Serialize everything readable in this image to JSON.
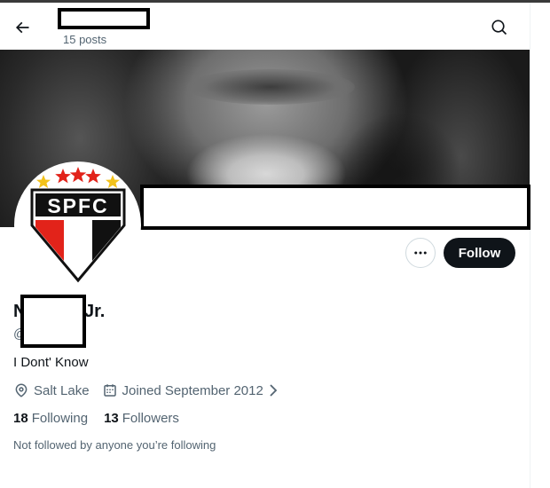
{
  "header": {
    "display_name": "",
    "post_count": "15 posts"
  },
  "profile": {
    "display_name_start": "N",
    "display_name_end": "Jr.",
    "handle_prefix": "@",
    "bio": "I Dont' Know",
    "location": "Salt Lake",
    "joined": "Joined September 2012",
    "following_count": "18",
    "following_label": "Following",
    "followers_count": "13",
    "followers_label": "Followers",
    "not_followed_text": "Not followed by anyone you’re following"
  },
  "actions": {
    "follow_label": "Follow"
  },
  "avatar": {
    "text": "SPFC",
    "colors": {
      "red": "#e2231a",
      "black": "#111111",
      "star_red": "#e2231a",
      "star_yellow": "#f2c21b"
    }
  },
  "icons": {
    "back": "arrow-left-icon",
    "search": "search-icon",
    "more": "more-horizontal-icon",
    "location": "location-pin-icon",
    "calendar": "calendar-icon",
    "chevron": "chevron-right-icon"
  },
  "theme": {
    "text_primary": "#0f1419",
    "text_secondary": "#536471",
    "button_bg": "#0f1419",
    "border": "#cfd9de"
  }
}
